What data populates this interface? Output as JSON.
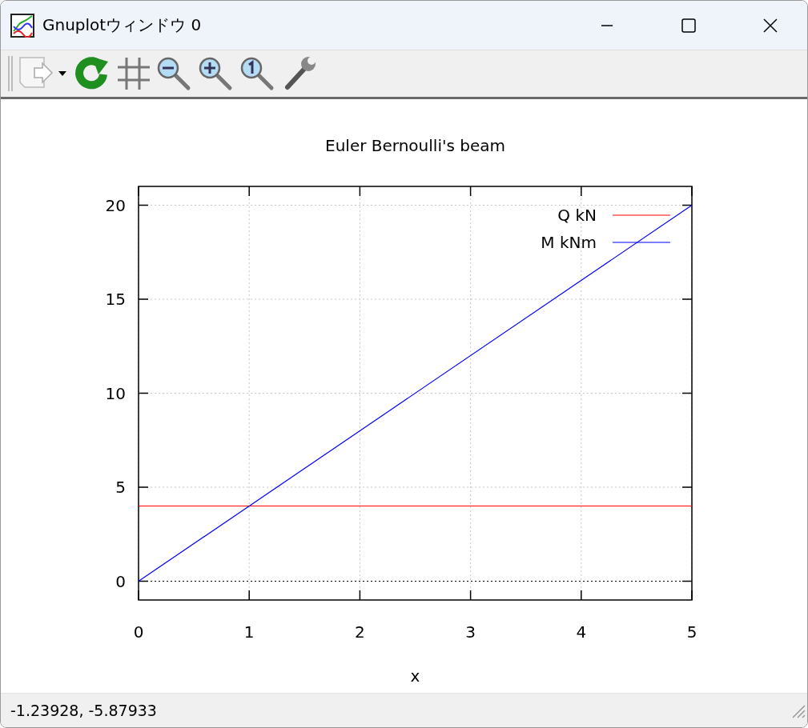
{
  "window": {
    "title": "Gnuplotウィンドウ 0"
  },
  "plot": {
    "chart_data": {
      "type": "line",
      "title": "Euler Bernoulli's beam",
      "xlabel": "x",
      "x": [
        0,
        5
      ],
      "series": [
        {
          "name": "Q kN",
          "color": "#ff0000",
          "values": [
            4,
            4
          ]
        },
        {
          "name": "M kNm",
          "color": "#0000ff",
          "values": [
            0,
            20
          ]
        }
      ],
      "xlim": [
        0,
        5
      ],
      "ylim": [
        -1,
        21
      ],
      "xticks": [
        0,
        1,
        2,
        3,
        4,
        5
      ],
      "yticks": [
        0,
        5,
        10,
        15,
        20
      ],
      "grid": true,
      "legend": true,
      "ref_lines": [
        {
          "axis": "y",
          "value": 0,
          "color": "#000000"
        }
      ]
    }
  },
  "status_bar": {
    "text": "-1.23928, -5.87933"
  }
}
